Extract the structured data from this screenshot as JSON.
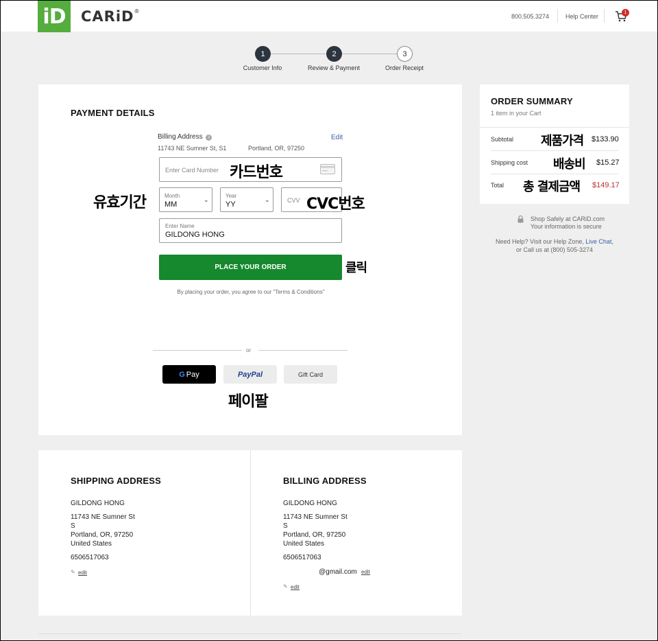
{
  "header": {
    "logo_icon": "iD",
    "logo_text": "CARiD",
    "phone": "800.505.3274",
    "help": "Help Center",
    "cart_count": "1"
  },
  "steps": [
    {
      "num": "1",
      "label": "Customer Info"
    },
    {
      "num": "2",
      "label": "Review & Payment"
    },
    {
      "num": "3",
      "label": "Order Receipt"
    }
  ],
  "payment": {
    "title": "PAYMENT DETAILS",
    "billing_label": "Billing Address",
    "billing_edit": "Edit",
    "billing_street": "11743 NE Sumner St, S1",
    "billing_city": "Portland, OR, 97250",
    "card_placeholder": "Enter Card Number",
    "month_label": "Month",
    "month_value": "MM",
    "year_label": "Year",
    "year_value": "YY",
    "cvv_placeholder": "CVV",
    "name_label": "Enter Name",
    "name_value": "GILDONG HONG",
    "order_button": "PLACE YOUR ORDER",
    "terms": "By placing your order, you agree to our \"Terms & Conditions\"",
    "or": "or",
    "gpay_g": "G",
    "gpay_pay": "Pay",
    "paypal": "PayPal",
    "gift_card": "Gift Card"
  },
  "annotations": {
    "card": "카드번호",
    "expiry": "유효기간",
    "cvc": "CVC번호",
    "click": "클릭",
    "paypal": "페이팔",
    "subtotal": "제품가격",
    "shipping": "배송비",
    "total": "총 결제금액"
  },
  "shipping_address": {
    "title": "SHIPPING ADDRESS",
    "name": "GILDONG HONG",
    "street": "11743 NE Sumner St",
    "unit": "S",
    "city": "Portland, OR, 97250",
    "country": "United States",
    "phone": "6506517063",
    "edit": "edit"
  },
  "billing_address": {
    "title": "BILLING ADDRESS",
    "name": "GILDONG HONG",
    "street": "11743 NE Sumner St",
    "unit": "S",
    "city": "Portland, OR, 97250",
    "country": "United States",
    "phone": "6506517063",
    "email": "@gmail.com",
    "email_edit": "edit",
    "edit": "edit"
  },
  "summary": {
    "title": "ORDER SUMMARY",
    "subtitle": "1 item in your Cart",
    "subtotal_label": "Subtotal",
    "subtotal_value": "$133.90",
    "shipping_label": "Shipping cost",
    "shipping_value": "$15.27",
    "total_label": "Total",
    "total_value": "$149.17"
  },
  "help": {
    "safe1": "Shop Safely at CARiD.com",
    "safe2": "Your information is secure",
    "need_help": "Need Help? Visit our Help Zone, ",
    "live_chat": "Live Chat",
    "comma": ",",
    "call": "or Call us at (800) 505-3274"
  },
  "colors": {
    "brand_green": "#55ad3e",
    "order_green": "#16882e",
    "total_red": "#b83232",
    "link_blue": "#3b5ea8"
  }
}
